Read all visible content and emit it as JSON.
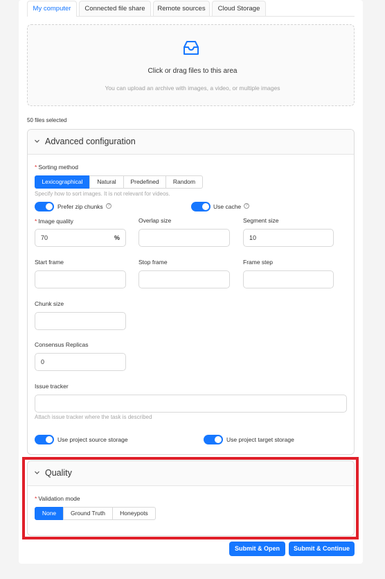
{
  "tabs": [
    {
      "label": "My computer"
    },
    {
      "label": "Connected file share"
    },
    {
      "label": "Remote sources"
    },
    {
      "label": "Cloud Storage"
    }
  ],
  "upload": {
    "title": "Click or drag files to this area",
    "hint": "You can upload an archive with images, a video, or multiple images",
    "icon": "inbox-icon"
  },
  "files_selected": "50 files selected",
  "advanced": {
    "title": "Advanced configuration",
    "sorting": {
      "label": "Sorting method",
      "options": [
        "Lexicographical",
        "Natural",
        "Predefined",
        "Random"
      ],
      "selected": "Lexicographical",
      "help": "Specify how to sort images. It is not relevant for videos."
    },
    "prefer_zip": {
      "label": "Prefer zip chunks",
      "on": true
    },
    "use_cache": {
      "label": "Use cache",
      "on": true
    },
    "image_quality": {
      "label": "Image quality",
      "value": "70",
      "suffix": "%"
    },
    "overlap_size": {
      "label": "Overlap size",
      "value": ""
    },
    "segment_size": {
      "label": "Segment size",
      "value": "10"
    },
    "start_frame": {
      "label": "Start frame",
      "value": ""
    },
    "stop_frame": {
      "label": "Stop frame",
      "value": ""
    },
    "frame_step": {
      "label": "Frame step",
      "value": ""
    },
    "chunk_size": {
      "label": "Chunk size",
      "value": ""
    },
    "consensus": {
      "label": "Consensus Replicas",
      "value": "0"
    },
    "issue_tracker": {
      "label": "Issue tracker",
      "value": "",
      "help": "Attach issue tracker where the task is described"
    },
    "source_storage": {
      "label": "Use project source storage",
      "on": true
    },
    "target_storage": {
      "label": "Use project target storage",
      "on": true
    }
  },
  "quality": {
    "title": "Quality",
    "validation": {
      "label": "Validation mode",
      "options": [
        "None",
        "Ground Truth",
        "Honeypots"
      ],
      "selected": "None"
    }
  },
  "buttons": {
    "submit_open": "Submit & Open",
    "submit_continue": "Submit & Continue"
  },
  "colors": {
    "accent": "#1677ff",
    "highlight": "#e0202a"
  }
}
